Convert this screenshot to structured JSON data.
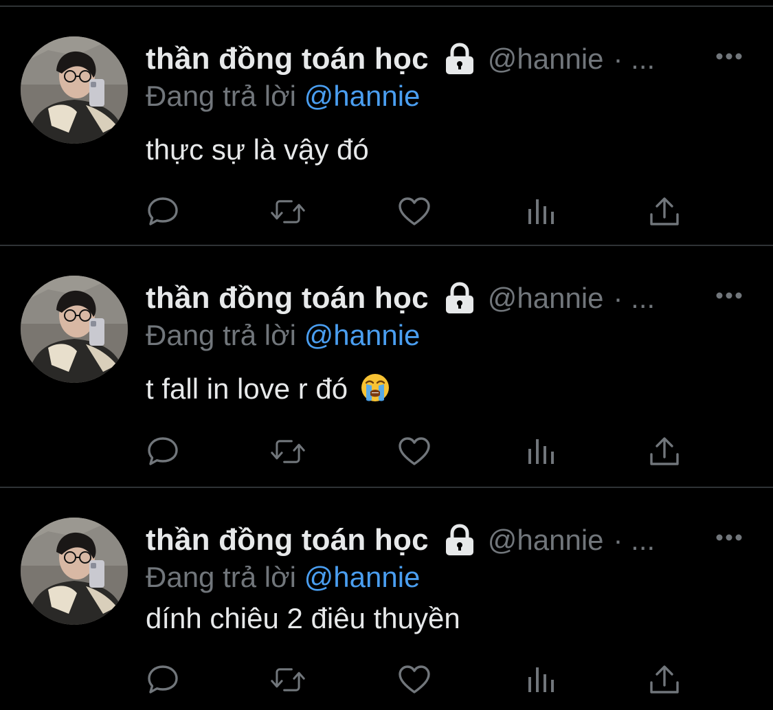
{
  "tweets": [
    {
      "display_name": "thần đồng toán học",
      "handle": "@hannie",
      "handle_suffix": "· ...",
      "reply_prefix": "Đang trả lời",
      "reply_mention": "@hannie",
      "text": "thực sự là vậy đó",
      "has_emoji": false
    },
    {
      "display_name": "thần đồng toán học",
      "handle": "@hannie",
      "handle_suffix": "· ...",
      "reply_prefix": "Đang trả lời",
      "reply_mention": "@hannie",
      "text": "t fall in love r đó",
      "has_emoji": true,
      "emoji": "loudly-crying-face"
    },
    {
      "display_name": "thần đồng toán học",
      "handle": "@hannie",
      "handle_suffix": "· ...",
      "reply_prefix": "Đang trả lời",
      "reply_mention": "@hannie",
      "text": "dính chiêu 2 điêu thuyền",
      "has_emoji": false
    }
  ],
  "icons": {
    "lock": "lock-icon",
    "more": "more-options-icon",
    "reply": "reply-bubble-icon",
    "retweet": "retweet-icon",
    "like": "heart-icon",
    "views": "views-bar-icon",
    "share": "share-upload-icon"
  },
  "colors": {
    "background": "#000000",
    "text": "#e7e9ea",
    "muted": "#71767b",
    "link": "#4a9ef0",
    "divider": "#2f3336"
  }
}
